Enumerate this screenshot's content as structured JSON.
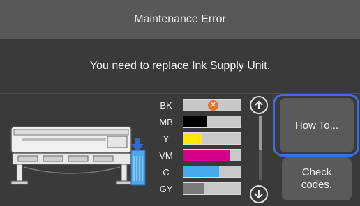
{
  "header": {
    "title": "Maintenance Error"
  },
  "message": {
    "text": "You need to replace Ink Supply Unit."
  },
  "inks": [
    {
      "label": "BK",
      "level": 0.0,
      "color": "#c8c8c8",
      "status": "error"
    },
    {
      "label": "MB",
      "level": 0.42,
      "color": "#000000",
      "status": "ok"
    },
    {
      "label": "Y",
      "level": 0.33,
      "color": "#ffe600",
      "status": "ok"
    },
    {
      "label": "VM",
      "level": 0.82,
      "color": "#d4008a",
      "status": "ok"
    },
    {
      "label": "C",
      "level": 0.62,
      "color": "#45a9ea",
      "status": "ok"
    },
    {
      "label": "GY",
      "level": 0.35,
      "color": "#7a7a7a",
      "status": "ok"
    }
  ],
  "buttons": {
    "how_to": "How To...",
    "check_codes": "Check codes."
  },
  "colors": {
    "title_bg": "#585858",
    "body_bg": "#3a3a3a",
    "focus": "#3d6de0",
    "error": "#ee6d2a"
  },
  "icons": {
    "scroll_up": "arrow-up-icon",
    "scroll_down": "arrow-down-icon",
    "error": "error-x-icon",
    "replace": "down-arrow-icon"
  }
}
